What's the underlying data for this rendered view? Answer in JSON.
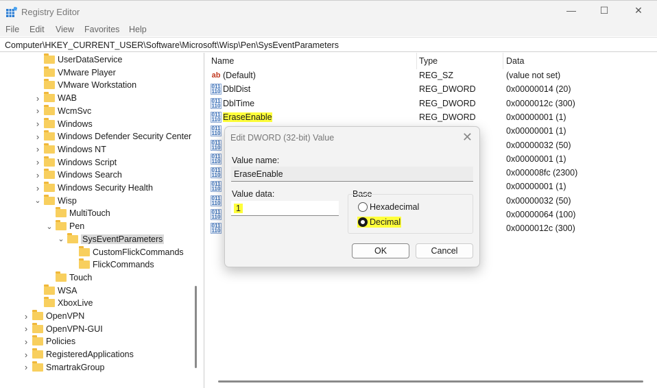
{
  "window": {
    "title": "Registry Editor",
    "minimize": "—",
    "maximize": "☐",
    "close": "✕"
  },
  "menu": [
    "File",
    "Edit",
    "View",
    "Favorites",
    "Help"
  ],
  "address": "Computer\\HKEY_CURRENT_USER\\Software\\Microsoft\\Wisp\\Pen\\SysEventParameters",
  "tree": [
    {
      "label": "UserDataService",
      "level": 2,
      "exp": ""
    },
    {
      "label": "VMware Player",
      "level": 2,
      "exp": ""
    },
    {
      "label": "VMware Workstation",
      "level": 2,
      "exp": ""
    },
    {
      "label": "WAB",
      "level": 2,
      "exp": ">"
    },
    {
      "label": "WcmSvc",
      "level": 2,
      "exp": ">"
    },
    {
      "label": "Windows",
      "level": 2,
      "exp": ">"
    },
    {
      "label": "Windows Defender Security Center",
      "level": 2,
      "exp": ">"
    },
    {
      "label": "Windows NT",
      "level": 2,
      "exp": ">"
    },
    {
      "label": "Windows Script",
      "level": 2,
      "exp": ">"
    },
    {
      "label": "Windows Search",
      "level": 2,
      "exp": ">"
    },
    {
      "label": "Windows Security Health",
      "level": 2,
      "exp": ">"
    },
    {
      "label": "Wisp",
      "level": 2,
      "exp": "v"
    },
    {
      "label": "MultiTouch",
      "level": 3,
      "exp": ""
    },
    {
      "label": "Pen",
      "level": 3,
      "exp": "v"
    },
    {
      "label": "SysEventParameters",
      "level": 4,
      "exp": "v",
      "selected": true
    },
    {
      "label": "CustomFlickCommands",
      "level": 5,
      "exp": ""
    },
    {
      "label": "FlickCommands",
      "level": 5,
      "exp": ""
    },
    {
      "label": "Touch",
      "level": 3,
      "exp": ""
    },
    {
      "label": "WSA",
      "level": 2,
      "exp": ""
    },
    {
      "label": "XboxLive",
      "level": 2,
      "exp": ""
    },
    {
      "label": "OpenVPN",
      "level": 1,
      "exp": ">"
    },
    {
      "label": "OpenVPN-GUI",
      "level": 1,
      "exp": ">"
    },
    {
      "label": "Policies",
      "level": 1,
      "exp": ">"
    },
    {
      "label": "RegisteredApplications",
      "level": 1,
      "exp": ">"
    },
    {
      "label": "SmartrakGroup",
      "level": 1,
      "exp": ">"
    }
  ],
  "columns": {
    "name": "Name",
    "type": "Type",
    "data": "Data"
  },
  "values": [
    {
      "name": "(Default)",
      "type": "REG_SZ",
      "data": "(value not set)",
      "icon": "ab"
    },
    {
      "name": "DblDist",
      "type": "REG_DWORD",
      "data": "0x00000014 (20)",
      "icon": "dword"
    },
    {
      "name": "DblTime",
      "type": "REG_DWORD",
      "data": "0x0000012c (300)",
      "icon": "dword"
    },
    {
      "name": "EraseEnable",
      "type": "REG_DWORD",
      "data": "0x00000001 (1)",
      "icon": "dword",
      "highlight": true
    },
    {
      "name": "",
      "type": "",
      "data": "0x00000001 (1)",
      "icon": "dword"
    },
    {
      "name": "",
      "type": "",
      "data": "0x00000032 (50)",
      "icon": "dword"
    },
    {
      "name": "",
      "type": "",
      "data": "0x00000001 (1)",
      "icon": "dword"
    },
    {
      "name": "",
      "type": "",
      "data": "0x000008fc (2300)",
      "icon": "dword"
    },
    {
      "name": "",
      "type": "",
      "data": "0x00000001 (1)",
      "icon": "dword"
    },
    {
      "name": "",
      "type": "",
      "data": "0x00000032 (50)",
      "icon": "dword"
    },
    {
      "name": "",
      "type": "",
      "data": "0x00000064 (100)",
      "icon": "dword"
    },
    {
      "name": "",
      "type": "",
      "data": "0x0000012c (300)",
      "icon": "dword"
    }
  ],
  "dialog": {
    "title": "Edit DWORD (32-bit) Value",
    "close": "✕",
    "value_name_label": "Value name:",
    "value_name": "EraseEnable",
    "value_data_label": "Value data:",
    "value_data": "1",
    "base_label": "Base",
    "hex_label": "Hexadecimal",
    "dec_label": "Decimal",
    "base_selected": "Decimal",
    "ok": "OK",
    "cancel": "Cancel"
  },
  "colors": {
    "highlight": "#ffff3a",
    "folder": "#f8cf5e"
  }
}
